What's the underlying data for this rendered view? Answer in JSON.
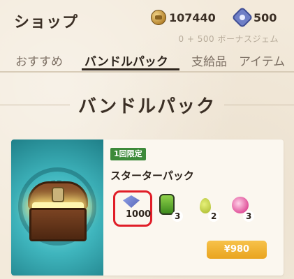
{
  "header": {
    "title": "ショップ",
    "coins": "107440",
    "gems": "500",
    "bonus_text": "0 + 500 ボーナスジェム"
  },
  "tabs": [
    {
      "label": "おすすめ"
    },
    {
      "label": "バンドルパック",
      "active": true
    },
    {
      "label": "支給品"
    },
    {
      "label": "アイテム"
    }
  ],
  "section": {
    "title": "バンドルパック"
  },
  "pack": {
    "badge": "1回限定",
    "name": "スターターパック",
    "items": [
      {
        "icon": "gem-icon",
        "count": "1000"
      },
      {
        "icon": "potion-icon",
        "count": "3"
      },
      {
        "icon": "seed-icon",
        "count": "2"
      },
      {
        "icon": "orb-icon",
        "count": "3"
      }
    ],
    "price": "¥980"
  },
  "colors": {
    "background": "#f3eadb",
    "badge": "#3d8a3a",
    "price_button": "#f0b030",
    "highlight": "#e01e28"
  }
}
